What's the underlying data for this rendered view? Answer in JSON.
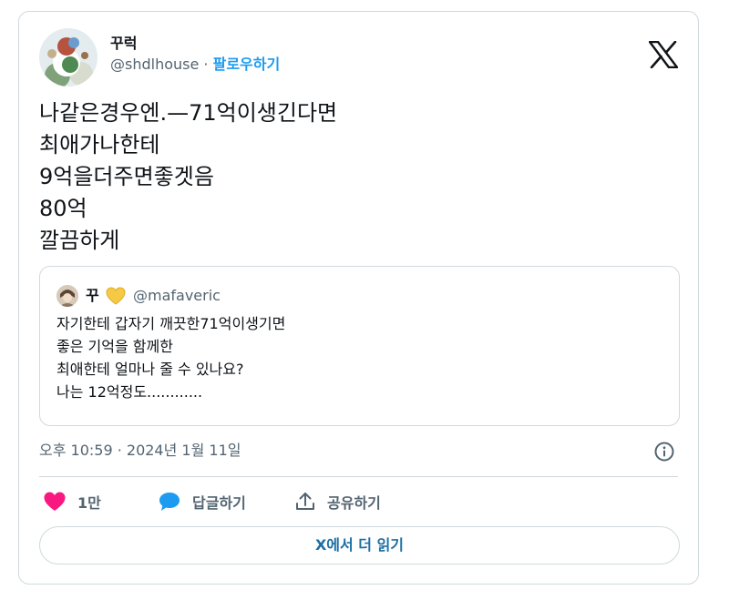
{
  "author": {
    "display_name": "꾸럭",
    "handle": "@shdlhouse",
    "separator": "·",
    "follow_label": "팔로우하기"
  },
  "tweet": {
    "lines": [
      "나같은경우엔.—71억이생긴다면",
      "최애가나한테",
      "9억을더주면좋겟음",
      "80억",
      "깔끔하게"
    ],
    "timestamp": "오후 10:59 · 2024년 1월 11일"
  },
  "quoted_tweet": {
    "display_name": "꾸",
    "handle": "@mafaveric",
    "lines": [
      "자기한테 갑자기 깨끗한71억이생기면",
      "좋은 기억을 함께한",
      "최애한테 얼마나 줄 수 있나요?",
      "나는 12억정도............"
    ]
  },
  "actions": {
    "like_count": "1만",
    "reply_label": "답글하기",
    "share_label": "공유하기"
  },
  "read_more_label": "X에서 더 읽기",
  "icons": {
    "like": "heart-icon",
    "reply": "speech-bubble-icon",
    "share": "share-icon",
    "info": "info-icon",
    "logo": "x-logo-icon",
    "quote_emoji": "yellow-heart-icon"
  },
  "colors": {
    "like": "#f91880",
    "reply": "#1d9bf0",
    "link": "#1d9bf0",
    "read_more": "#1d6fa5",
    "border": "#cfd9de",
    "muted_text": "#536471"
  }
}
